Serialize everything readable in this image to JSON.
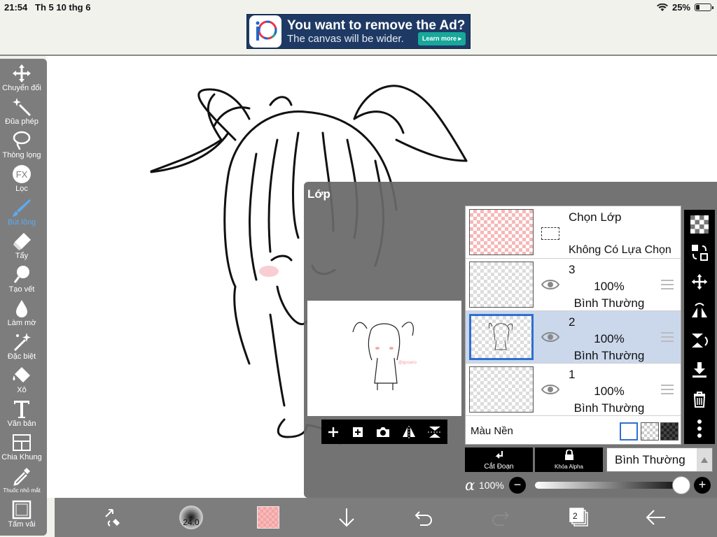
{
  "status_bar": {
    "time": "21:54",
    "date": "Th 5 10 thg 6",
    "battery": "25%",
    "battery_level": 0.25
  },
  "ad": {
    "title": "You want to remove the Ad?",
    "subtitle": "The canvas will be wider.",
    "button": "Learn more ▸"
  },
  "tools": [
    {
      "label": "Chuyển đổi",
      "icon": "move-icon",
      "active": false
    },
    {
      "label": "Đũa phép",
      "icon": "magic-wand-icon",
      "active": false
    },
    {
      "label": "Thòng lọng",
      "icon": "lasso-icon",
      "active": false
    },
    {
      "label": "Lọc",
      "icon": "fx-filter-icon",
      "active": false
    },
    {
      "label": "Bút lông",
      "icon": "brush-icon",
      "active": true
    },
    {
      "label": "Tẩy",
      "icon": "eraser-icon",
      "active": false
    },
    {
      "label": "Tạo vết",
      "icon": "smudge-icon",
      "active": false
    },
    {
      "label": "Làm mờ",
      "icon": "blur-drop-icon",
      "active": false
    },
    {
      "label": "Đặc biệt",
      "icon": "special-sparkle-icon",
      "active": false
    },
    {
      "label": "Xô",
      "icon": "bucket-icon",
      "active": false
    },
    {
      "label": "Văn bản",
      "icon": "text-icon",
      "active": false
    },
    {
      "label": "Chia Khung",
      "icon": "frame-divider-icon",
      "active": false
    },
    {
      "label": "Thuốc nhỏ mắt",
      "icon": "eyedropper-icon",
      "active": false
    },
    {
      "label": "Tấm vải",
      "icon": "canvas-icon",
      "active": false
    }
  ],
  "layer_panel": {
    "title": "Lớp",
    "selection_row": {
      "label": "Chọn Lớp",
      "sub": "Không Có Lựa Chọn"
    },
    "layers": [
      {
        "number": "3",
        "opacity": "100%",
        "mode": "Bình Thường",
        "selected": false
      },
      {
        "number": "2",
        "opacity": "100%",
        "mode": "Bình Thường",
        "selected": true
      },
      {
        "number": "1",
        "opacity": "100%",
        "mode": "Bình Thường",
        "selected": false
      }
    ],
    "background_label": "Màu Nền",
    "clip_button": "Cắt Đoạn",
    "alpha_lock_button": "Khóa Alpha",
    "blend_mode": "Bình Thường",
    "opacity_value": "100%",
    "opacity_level": 1.0,
    "preview_watermark": "@gusano"
  },
  "bottom_bar": {
    "brush_size": "24.0",
    "layer_count": "2",
    "color": "#f4a3a3"
  }
}
